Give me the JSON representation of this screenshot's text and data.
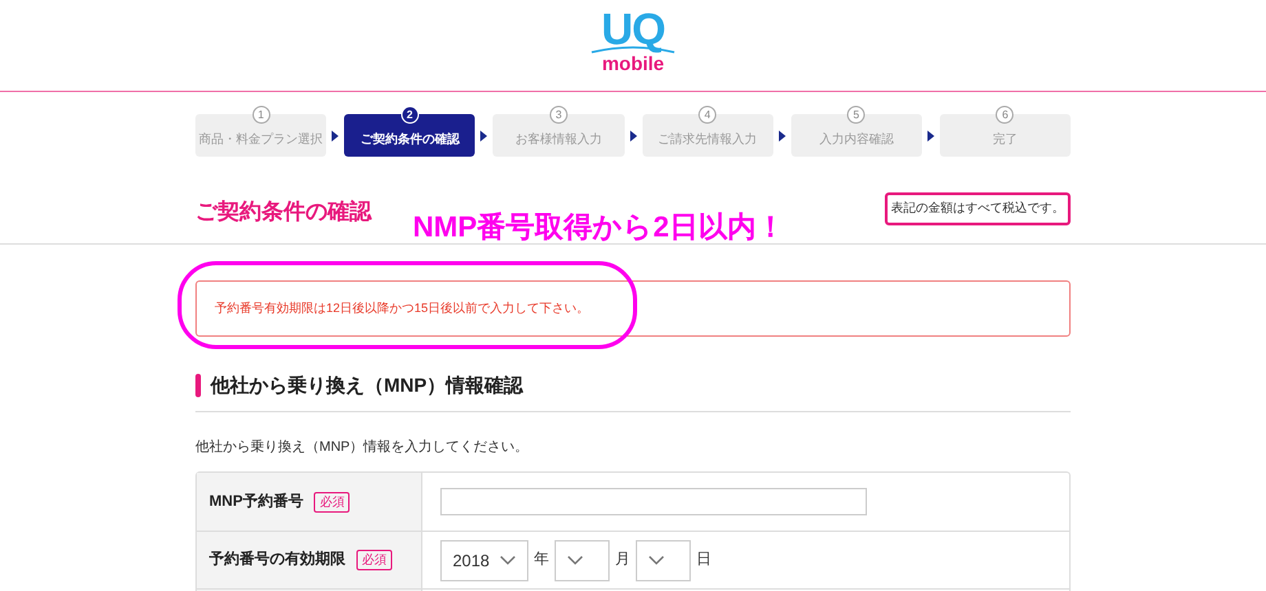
{
  "logo": {
    "primary": "UQ",
    "secondary": "mobile"
  },
  "steps": [
    {
      "number": "1",
      "label": "商品・料金プラン選択",
      "selected": false
    },
    {
      "number": "2",
      "label": "ご契約条件の確認",
      "selected": true
    },
    {
      "number": "3",
      "label": "お客様情報入力",
      "selected": false
    },
    {
      "number": "4",
      "label": "ご請求先情報入力",
      "selected": false
    },
    {
      "number": "5",
      "label": "入力内容確認",
      "selected": false
    },
    {
      "number": "6",
      "label": "完了",
      "selected": false
    }
  ],
  "page_title": "ご契約条件の確認",
  "tax_note": "表記の金額はすべて税込です。",
  "annotation": "NMP番号取得から2日以内！",
  "alert": "予約番号有効期限は12日後以降かつ15日後以前で入力して下さい。",
  "section_heading": "他社から乗り換え（MNP）情報確認",
  "description": "他社から乗り換え（MNP）情報を入力してください。",
  "form_rows": [
    {
      "kind": "text",
      "label": "MNP予約番号",
      "badge": "必須"
    },
    {
      "kind": "date",
      "label": "予約番号の有効期限",
      "badge": "必須",
      "year": "2018",
      "year_unit": "年",
      "month_unit": "月",
      "day_unit": "日"
    },
    {
      "kind": "blank"
    }
  ]
}
